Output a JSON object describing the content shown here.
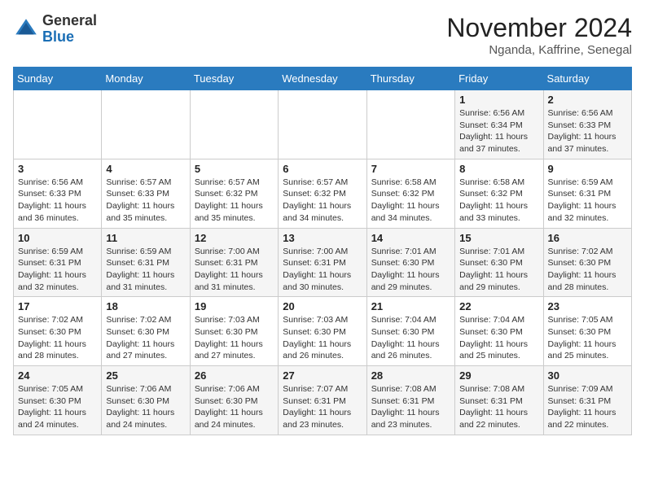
{
  "header": {
    "logo_line1": "General",
    "logo_line2": "Blue",
    "month": "November 2024",
    "location": "Nganda, Kaffrine, Senegal"
  },
  "weekdays": [
    "Sunday",
    "Monday",
    "Tuesday",
    "Wednesday",
    "Thursday",
    "Friday",
    "Saturday"
  ],
  "weeks": [
    [
      {
        "day": "",
        "info": ""
      },
      {
        "day": "",
        "info": ""
      },
      {
        "day": "",
        "info": ""
      },
      {
        "day": "",
        "info": ""
      },
      {
        "day": "",
        "info": ""
      },
      {
        "day": "1",
        "info": "Sunrise: 6:56 AM\nSunset: 6:34 PM\nDaylight: 11 hours\nand 37 minutes."
      },
      {
        "day": "2",
        "info": "Sunrise: 6:56 AM\nSunset: 6:33 PM\nDaylight: 11 hours\nand 37 minutes."
      }
    ],
    [
      {
        "day": "3",
        "info": "Sunrise: 6:56 AM\nSunset: 6:33 PM\nDaylight: 11 hours\nand 36 minutes."
      },
      {
        "day": "4",
        "info": "Sunrise: 6:57 AM\nSunset: 6:33 PM\nDaylight: 11 hours\nand 35 minutes."
      },
      {
        "day": "5",
        "info": "Sunrise: 6:57 AM\nSunset: 6:32 PM\nDaylight: 11 hours\nand 35 minutes."
      },
      {
        "day": "6",
        "info": "Sunrise: 6:57 AM\nSunset: 6:32 PM\nDaylight: 11 hours\nand 34 minutes."
      },
      {
        "day": "7",
        "info": "Sunrise: 6:58 AM\nSunset: 6:32 PM\nDaylight: 11 hours\nand 34 minutes."
      },
      {
        "day": "8",
        "info": "Sunrise: 6:58 AM\nSunset: 6:32 PM\nDaylight: 11 hours\nand 33 minutes."
      },
      {
        "day": "9",
        "info": "Sunrise: 6:59 AM\nSunset: 6:31 PM\nDaylight: 11 hours\nand 32 minutes."
      }
    ],
    [
      {
        "day": "10",
        "info": "Sunrise: 6:59 AM\nSunset: 6:31 PM\nDaylight: 11 hours\nand 32 minutes."
      },
      {
        "day": "11",
        "info": "Sunrise: 6:59 AM\nSunset: 6:31 PM\nDaylight: 11 hours\nand 31 minutes."
      },
      {
        "day": "12",
        "info": "Sunrise: 7:00 AM\nSunset: 6:31 PM\nDaylight: 11 hours\nand 31 minutes."
      },
      {
        "day": "13",
        "info": "Sunrise: 7:00 AM\nSunset: 6:31 PM\nDaylight: 11 hours\nand 30 minutes."
      },
      {
        "day": "14",
        "info": "Sunrise: 7:01 AM\nSunset: 6:30 PM\nDaylight: 11 hours\nand 29 minutes."
      },
      {
        "day": "15",
        "info": "Sunrise: 7:01 AM\nSunset: 6:30 PM\nDaylight: 11 hours\nand 29 minutes."
      },
      {
        "day": "16",
        "info": "Sunrise: 7:02 AM\nSunset: 6:30 PM\nDaylight: 11 hours\nand 28 minutes."
      }
    ],
    [
      {
        "day": "17",
        "info": "Sunrise: 7:02 AM\nSunset: 6:30 PM\nDaylight: 11 hours\nand 28 minutes."
      },
      {
        "day": "18",
        "info": "Sunrise: 7:02 AM\nSunset: 6:30 PM\nDaylight: 11 hours\nand 27 minutes."
      },
      {
        "day": "19",
        "info": "Sunrise: 7:03 AM\nSunset: 6:30 PM\nDaylight: 11 hours\nand 27 minutes."
      },
      {
        "day": "20",
        "info": "Sunrise: 7:03 AM\nSunset: 6:30 PM\nDaylight: 11 hours\nand 26 minutes."
      },
      {
        "day": "21",
        "info": "Sunrise: 7:04 AM\nSunset: 6:30 PM\nDaylight: 11 hours\nand 26 minutes."
      },
      {
        "day": "22",
        "info": "Sunrise: 7:04 AM\nSunset: 6:30 PM\nDaylight: 11 hours\nand 25 minutes."
      },
      {
        "day": "23",
        "info": "Sunrise: 7:05 AM\nSunset: 6:30 PM\nDaylight: 11 hours\nand 25 minutes."
      }
    ],
    [
      {
        "day": "24",
        "info": "Sunrise: 7:05 AM\nSunset: 6:30 PM\nDaylight: 11 hours\nand 24 minutes."
      },
      {
        "day": "25",
        "info": "Sunrise: 7:06 AM\nSunset: 6:30 PM\nDaylight: 11 hours\nand 24 minutes."
      },
      {
        "day": "26",
        "info": "Sunrise: 7:06 AM\nSunset: 6:30 PM\nDaylight: 11 hours\nand 24 minutes."
      },
      {
        "day": "27",
        "info": "Sunrise: 7:07 AM\nSunset: 6:31 PM\nDaylight: 11 hours\nand 23 minutes."
      },
      {
        "day": "28",
        "info": "Sunrise: 7:08 AM\nSunset: 6:31 PM\nDaylight: 11 hours\nand 23 minutes."
      },
      {
        "day": "29",
        "info": "Sunrise: 7:08 AM\nSunset: 6:31 PM\nDaylight: 11 hours\nand 22 minutes."
      },
      {
        "day": "30",
        "info": "Sunrise: 7:09 AM\nSunset: 6:31 PM\nDaylight: 11 hours\nand 22 minutes."
      }
    ]
  ]
}
